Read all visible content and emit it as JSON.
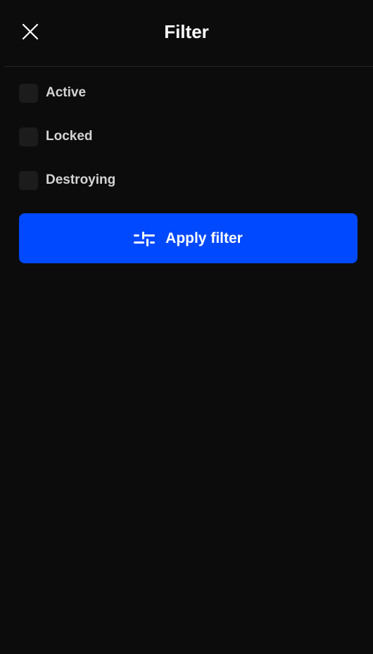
{
  "header": {
    "title": "Filter",
    "close_icon": "close-icon"
  },
  "filters": [
    {
      "label": "Active",
      "checked": false
    },
    {
      "label": "Locked",
      "checked": false
    },
    {
      "label": "Destroying",
      "checked": false
    }
  ],
  "apply_button": {
    "label": "Apply filter",
    "icon": "sliders-icon"
  },
  "colors": {
    "background": "#0c0c0c",
    "accent": "#0049ff",
    "checkbox": "#1c1c1c",
    "text": "#ffffff",
    "label": "#d4d4d4"
  }
}
